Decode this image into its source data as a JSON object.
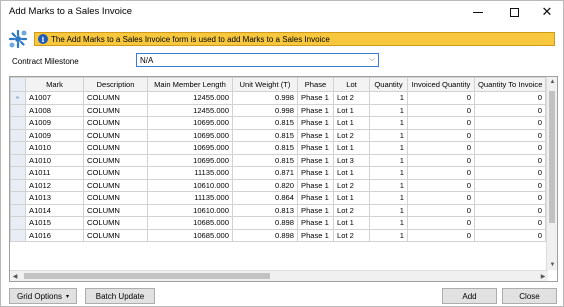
{
  "window": {
    "title": "Add Marks to a Sales Invoice",
    "min_glyph": "",
    "max_glyph": "",
    "close_glyph": "✕"
  },
  "info": {
    "text": "The Add Marks to a Sales Invoice form is used to add Marks to a Sales Invoice",
    "icon_glyph": "i"
  },
  "milestone": {
    "label": "Contract Milestone",
    "value": "N/A",
    "arrow": "⌵"
  },
  "grid": {
    "columns": [
      "Mark",
      "Description",
      "Main Member Length",
      "Unit Weight (T)",
      "Phase",
      "Lot",
      "Quantity",
      "Invoiced Quantity",
      "Quantity To Invoice"
    ],
    "current_marker": "▸",
    "rows": [
      {
        "mark": "A1007",
        "desc": "COLUMN",
        "length": "12455.000",
        "weight": "0.998",
        "phase": "Phase 1",
        "lot": "Lot 2",
        "qty": "1",
        "invoiced": "0",
        "to_invoice": "0"
      },
      {
        "mark": "A1008",
        "desc": "COLUMN",
        "length": "12455.000",
        "weight": "0.998",
        "phase": "Phase 1",
        "lot": "Lot 1",
        "qty": "1",
        "invoiced": "0",
        "to_invoice": "0"
      },
      {
        "mark": "A1009",
        "desc": "COLUMN",
        "length": "10695.000",
        "weight": "0.815",
        "phase": "Phase 1",
        "lot": "Lot 1",
        "qty": "1",
        "invoiced": "0",
        "to_invoice": "0"
      },
      {
        "mark": "A1009",
        "desc": "COLUMN",
        "length": "10695.000",
        "weight": "0.815",
        "phase": "Phase 1",
        "lot": "Lot 2",
        "qty": "1",
        "invoiced": "0",
        "to_invoice": "0"
      },
      {
        "mark": "A1010",
        "desc": "COLUMN",
        "length": "10695.000",
        "weight": "0.815",
        "phase": "Phase 1",
        "lot": "Lot 1",
        "qty": "1",
        "invoiced": "0",
        "to_invoice": "0"
      },
      {
        "mark": "A1010",
        "desc": "COLUMN",
        "length": "10695.000",
        "weight": "0.815",
        "phase": "Phase 1",
        "lot": "Lot 3",
        "qty": "1",
        "invoiced": "0",
        "to_invoice": "0"
      },
      {
        "mark": "A1011",
        "desc": "COLUMN",
        "length": "11135.000",
        "weight": "0.871",
        "phase": "Phase 1",
        "lot": "Lot 1",
        "qty": "1",
        "invoiced": "0",
        "to_invoice": "0"
      },
      {
        "mark": "A1012",
        "desc": "COLUMN",
        "length": "10610.000",
        "weight": "0.820",
        "phase": "Phase 1",
        "lot": "Lot 2",
        "qty": "1",
        "invoiced": "0",
        "to_invoice": "0"
      },
      {
        "mark": "A1013",
        "desc": "COLUMN",
        "length": "11135.000",
        "weight": "0.864",
        "phase": "Phase 1",
        "lot": "Lot 1",
        "qty": "1",
        "invoiced": "0",
        "to_invoice": "0"
      },
      {
        "mark": "A1014",
        "desc": "COLUMN",
        "length": "10610.000",
        "weight": "0.813",
        "phase": "Phase 1",
        "lot": "Lot 2",
        "qty": "1",
        "invoiced": "0",
        "to_invoice": "0"
      },
      {
        "mark": "A1015",
        "desc": "COLUMN",
        "length": "10685.000",
        "weight": "0.898",
        "phase": "Phase 1",
        "lot": "Lot 1",
        "qty": "1",
        "invoiced": "0",
        "to_invoice": "0"
      },
      {
        "mark": "A1016",
        "desc": "COLUMN",
        "length": "10685.000",
        "weight": "0.898",
        "phase": "Phase 1",
        "lot": "Lot 2",
        "qty": "1",
        "invoiced": "0",
        "to_invoice": "0"
      }
    ]
  },
  "scroll": {
    "up": "▲",
    "down": "▼",
    "left": "◀",
    "right": "▶"
  },
  "buttons": {
    "grid_options": "Grid Options",
    "grid_options_caret": "▾",
    "batch_update": "Batch Update",
    "add": "Add",
    "close": "Close"
  },
  "colors": {
    "info_bg": "#f7c83d",
    "info_border": "#d19a1a",
    "accent_blue": "#3a7bd5"
  },
  "icons": {
    "app": "gear-cluster-icon",
    "info": "info-icon",
    "dropdown": "chevron-down-icon",
    "row_marker": "row-pointer-icon"
  }
}
